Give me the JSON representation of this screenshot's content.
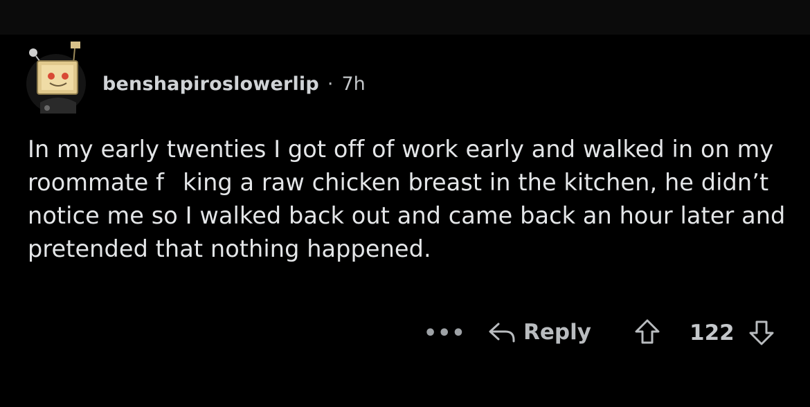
{
  "comment": {
    "author": "benshapiroslowerlip",
    "separator": "·",
    "age": "7h",
    "text": "In my early twenties I got off of work early and walked in on my roommate f    king a raw chicken breast in the kitchen, he didn’t notice me so I walked back out and came back an hour later and pretended that nothing happened."
  },
  "actions": {
    "more_label": "•••",
    "reply_label": "Reply",
    "score": "122"
  },
  "colors": {
    "background": "#000000",
    "text": "#e4e6e8",
    "muted": "#b9bcbf"
  },
  "icons": {
    "avatar": "snoo-avatar",
    "reply": "reply-arrow-icon",
    "upvote": "upvote-arrow-icon",
    "downvote": "downvote-arrow-icon"
  }
}
